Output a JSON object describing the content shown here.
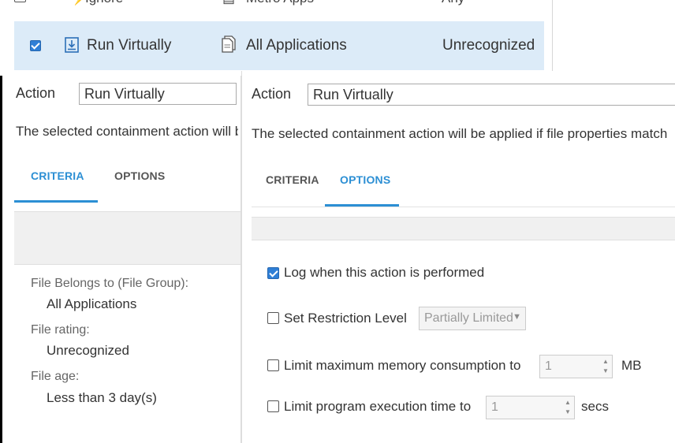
{
  "top_list": {
    "partial_row": {
      "col1": "Ignore",
      "col2": "Metro Apps",
      "col3": "Any"
    },
    "selected_row": {
      "action": "Run Virtually",
      "file_group": "All Applications",
      "rating": "Unrecognized"
    }
  },
  "left_panel": {
    "action_label": "Action",
    "action_value": "Run Virtually",
    "description": "The selected containment action will be applied if file properties match",
    "tabs": [
      {
        "label": "CRITERIA",
        "active": true
      },
      {
        "label": "OPTIONS",
        "active": false
      }
    ],
    "criteria": [
      {
        "label": "File Belongs to (File Group):",
        "value": "All Applications"
      },
      {
        "label": "File rating:",
        "value": "Unrecognized"
      },
      {
        "label": "File age:",
        "value": "Less than 3 day(s)"
      }
    ]
  },
  "right_panel": {
    "action_label": "Action",
    "action_value": "Run Virtually",
    "description": "The selected containment action will be applied if file properties match",
    "tabs": [
      {
        "label": "CRITERIA",
        "active": false
      },
      {
        "label": "OPTIONS",
        "active": true
      }
    ],
    "options": {
      "log": {
        "label": "Log when this action is performed",
        "checked": true
      },
      "restriction": {
        "label": "Set Restriction Level",
        "checked": false,
        "value": "Partially Limited"
      },
      "memory": {
        "label": "Limit maximum memory consumption to",
        "checked": false,
        "value": "1",
        "unit": "MB"
      },
      "exec_time": {
        "label": "Limit program execution time to",
        "checked": false,
        "value": "1",
        "unit": "secs"
      }
    }
  },
  "colors": {
    "accent": "#2c8fd4",
    "selected_row": "#dcebf8",
    "gray_band": "#f0f0f0"
  }
}
